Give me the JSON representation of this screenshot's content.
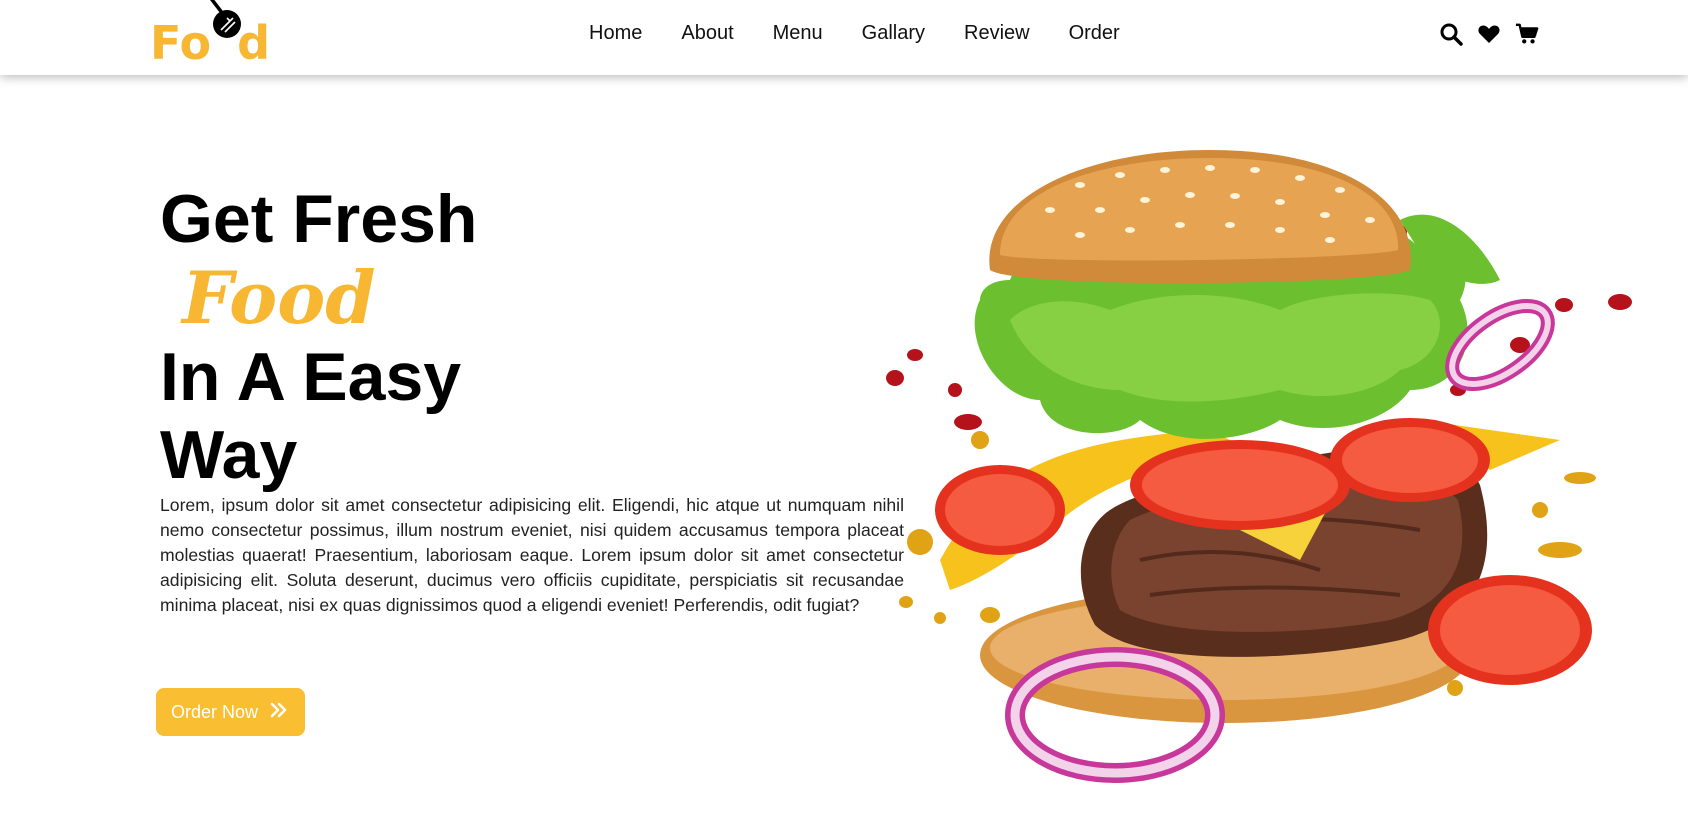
{
  "brand": {
    "logo_prefix": "Fo",
    "logo_suffix": "d",
    "accent_color": "#f7b733"
  },
  "nav": {
    "items": [
      "Home",
      "About",
      "Menu",
      "Gallary",
      "Review",
      "Order"
    ],
    "icons": [
      "search-icon",
      "heart-icon",
      "cart-icon"
    ]
  },
  "hero": {
    "line1": "Get Fresh",
    "accent": "Food",
    "line2": "In A Easy",
    "line3": "Way",
    "description": "Lorem, ipsum dolor sit amet consectetur adipisicing elit. Eligendi, hic atque ut numquam nihil nemo consectetur possimus, illum nostrum eveniet, nisi quidem accusamus tempora placeat molestias quaerat! Praesentium, laboriosam eaque. Lorem ipsum dolor sit amet consectetur adipisicing elit. Soluta deserunt, ducimus vero officiis cupiditate, perspiciatis sit recusandae minima placeat, nisi ex quas dignissimos quod a eligendi eveniet! Perferendis, odit fugiat?",
    "button_label": "Order Now",
    "button_color": "#f9be32"
  }
}
